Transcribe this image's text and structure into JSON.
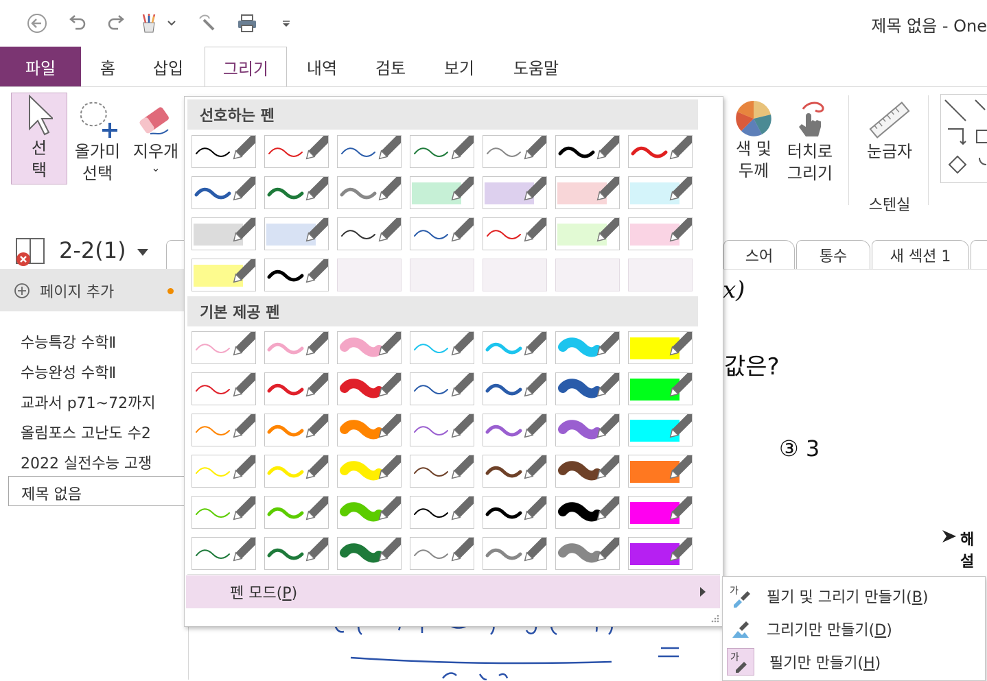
{
  "window": {
    "title": "제목 없음  -  One"
  },
  "tabs": [
    {
      "label": "파일"
    },
    {
      "label": "홈"
    },
    {
      "label": "삽입"
    },
    {
      "label": "그리기"
    },
    {
      "label": "내역"
    },
    {
      "label": "검토"
    },
    {
      "label": "보기"
    },
    {
      "label": "도움말"
    }
  ],
  "ribbon": {
    "select": "선\n택",
    "lasso": "올가미\n선택",
    "eraser": "지우개",
    "eraser_chevron": "⌄",
    "color_thickness": "색 및\n두께",
    "touch_draw": "터치로\n그리기",
    "ruler": "눈금자",
    "stencil_group": "스텐실"
  },
  "notebook": {
    "name": "2-2(1)",
    "add_page": "페이지 추가"
  },
  "sections": [
    {
      "label": "스어"
    },
    {
      "label": "통수"
    },
    {
      "label": "새 섹션 1"
    }
  ],
  "pages": [
    {
      "label": "수능특강 수학Ⅱ"
    },
    {
      "label": "수능완성 수학Ⅱ"
    },
    {
      "label": "교과서 p71~72까지"
    },
    {
      "label": "올림포스 고난도 수2"
    },
    {
      "label": "2022 실전수능 고쟁"
    },
    {
      "label": "제목 없음"
    }
  ],
  "canvas": {
    "frag1": "x)",
    "frag2": "값은?",
    "frag3": "③ 3",
    "frag4": "해설"
  },
  "pen_gallery": {
    "favorites_header": "선호하는 펜",
    "builtin_header": "기본 제공 펜",
    "pen_mode_label": "펜 모드(",
    "pen_mode_key": "P",
    "pen_mode_close": ")",
    "favorites": [
      {
        "color": "#000000",
        "style": "thin"
      },
      {
        "color": "#e02020",
        "style": "thin"
      },
      {
        "color": "#2a5caa",
        "style": "thin"
      },
      {
        "color": "#1e7a3a",
        "style": "thin"
      },
      {
        "color": "#888888",
        "style": "thin"
      },
      {
        "color": "#000000",
        "style": "medium"
      },
      {
        "color": "#e02020",
        "style": "medium"
      },
      {
        "color": "#2a5caa",
        "style": "medium"
      },
      {
        "color": "#1e7a3a",
        "style": "medium"
      },
      {
        "color": "#888888",
        "style": "medium"
      },
      {
        "color": "#c6f0d6",
        "style": "hl"
      },
      {
        "color": "#ddd0ee",
        "style": "hl"
      },
      {
        "color": "#f8d6d8",
        "style": "hl"
      },
      {
        "color": "#d4f4fa",
        "style": "hl"
      },
      {
        "color": "#dcdcdc",
        "style": "hl"
      },
      {
        "color": "#d8e2f4",
        "style": "hl"
      },
      {
        "color": "#333333",
        "style": "thin"
      },
      {
        "color": "#2a5caa",
        "style": "thin"
      },
      {
        "color": "#e02020",
        "style": "thin"
      },
      {
        "color": "#e2fad4",
        "style": "hl"
      },
      {
        "color": "#fad4e4",
        "style": "hl"
      },
      {
        "color": "#fdfb8e",
        "style": "hl"
      },
      {
        "color": "#000000",
        "style": "medium"
      },
      {
        "color": "",
        "style": "empty"
      },
      {
        "color": "",
        "style": "empty"
      },
      {
        "color": "",
        "style": "empty"
      },
      {
        "color": "",
        "style": "empty"
      },
      {
        "color": "",
        "style": "empty"
      }
    ],
    "builtin": [
      {
        "color": "#f4a6c6",
        "style": "thin"
      },
      {
        "color": "#f4a6c6",
        "style": "medium"
      },
      {
        "color": "#f4a6c6",
        "style": "thick"
      },
      {
        "color": "#1cc4ee",
        "style": "thin"
      },
      {
        "color": "#1cc4ee",
        "style": "medium"
      },
      {
        "color": "#1cc4ee",
        "style": "thick"
      },
      {
        "color": "#ffff00",
        "style": "hl"
      },
      {
        "color": "#e0202a",
        "style": "thin"
      },
      {
        "color": "#e0202a",
        "style": "medium"
      },
      {
        "color": "#e0202a",
        "style": "thick"
      },
      {
        "color": "#2a5caa",
        "style": "thin"
      },
      {
        "color": "#2a5caa",
        "style": "medium"
      },
      {
        "color": "#2a5caa",
        "style": "thick"
      },
      {
        "color": "#00ff1a",
        "style": "hl"
      },
      {
        "color": "#ff8400",
        "style": "thin"
      },
      {
        "color": "#ff8400",
        "style": "medium"
      },
      {
        "color": "#ff8400",
        "style": "thick"
      },
      {
        "color": "#9a5fd0",
        "style": "thin"
      },
      {
        "color": "#9a5fd0",
        "style": "medium"
      },
      {
        "color": "#9a5fd0",
        "style": "thick"
      },
      {
        "color": "#00ffff",
        "style": "hl"
      },
      {
        "color": "#ffee00",
        "style": "thin"
      },
      {
        "color": "#ffee00",
        "style": "medium"
      },
      {
        "color": "#ffee00",
        "style": "thick"
      },
      {
        "color": "#6e4128",
        "style": "thin"
      },
      {
        "color": "#6e4128",
        "style": "medium"
      },
      {
        "color": "#6e4128",
        "style": "thick"
      },
      {
        "color": "#ff7820",
        "style": "hl"
      },
      {
        "color": "#5ccc00",
        "style": "thin"
      },
      {
        "color": "#5ccc00",
        "style": "medium"
      },
      {
        "color": "#5ccc00",
        "style": "thick"
      },
      {
        "color": "#000000",
        "style": "thin"
      },
      {
        "color": "#000000",
        "style": "medium"
      },
      {
        "color": "#000000",
        "style": "thick"
      },
      {
        "color": "#ff00f0",
        "style": "hl"
      },
      {
        "color": "#1e7a3a",
        "style": "thin"
      },
      {
        "color": "#1e7a3a",
        "style": "medium"
      },
      {
        "color": "#1e7a3a",
        "style": "thick"
      },
      {
        "color": "#888888",
        "style": "thin"
      },
      {
        "color": "#888888",
        "style": "medium"
      },
      {
        "color": "#888888",
        "style": "thick"
      },
      {
        "color": "#b620f2",
        "style": "hl"
      }
    ]
  },
  "pen_mode_submenu": [
    {
      "label": "필기 및 그리기 만들기(",
      "key": "B",
      "close": ")"
    },
    {
      "label": "그리기만 만들기(",
      "key": "D",
      "close": ")"
    },
    {
      "label": "필기만 만들기(",
      "key": "H",
      "close": ")"
    }
  ],
  "colors": {
    "accent": "#7b3572",
    "select_bg": "#efd9ee",
    "penmode_bg": "#f0dcee"
  }
}
